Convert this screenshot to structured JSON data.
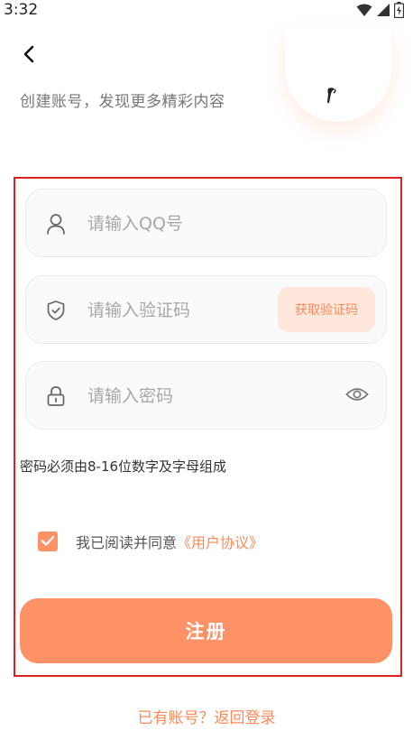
{
  "status_bar": {
    "time": "3:32",
    "icons": [
      "wifi-icon",
      "signal-icon",
      "battery-icon"
    ]
  },
  "header": {
    "back_icon": "chevron-left-icon",
    "subtitle": "创建账号，发现更多精彩内容"
  },
  "form": {
    "qq": {
      "icon": "user-icon",
      "placeholder": "请输入QQ号",
      "value": ""
    },
    "code": {
      "icon": "shield-check-icon",
      "placeholder": "请输入验证码",
      "value": "",
      "button_label": "获取验证码"
    },
    "password": {
      "icon": "lock-icon",
      "placeholder": "请输入密码",
      "value": "",
      "toggle_icon": "eye-icon"
    },
    "password_hint": "密码必须由8-16位数字及字母组成",
    "agreement": {
      "checked": true,
      "text": "我已阅读并同意",
      "link_text": "《用户协议》"
    },
    "submit_label": "注册"
  },
  "footer": {
    "login_link": "已有账号？返回登录"
  },
  "colors": {
    "accent": "#ff9166",
    "accent_text": "#ff8a5a",
    "code_button_bg": "#ffe7dc",
    "field_bg": "#fafafa",
    "highlight_border": "#dd2020"
  }
}
